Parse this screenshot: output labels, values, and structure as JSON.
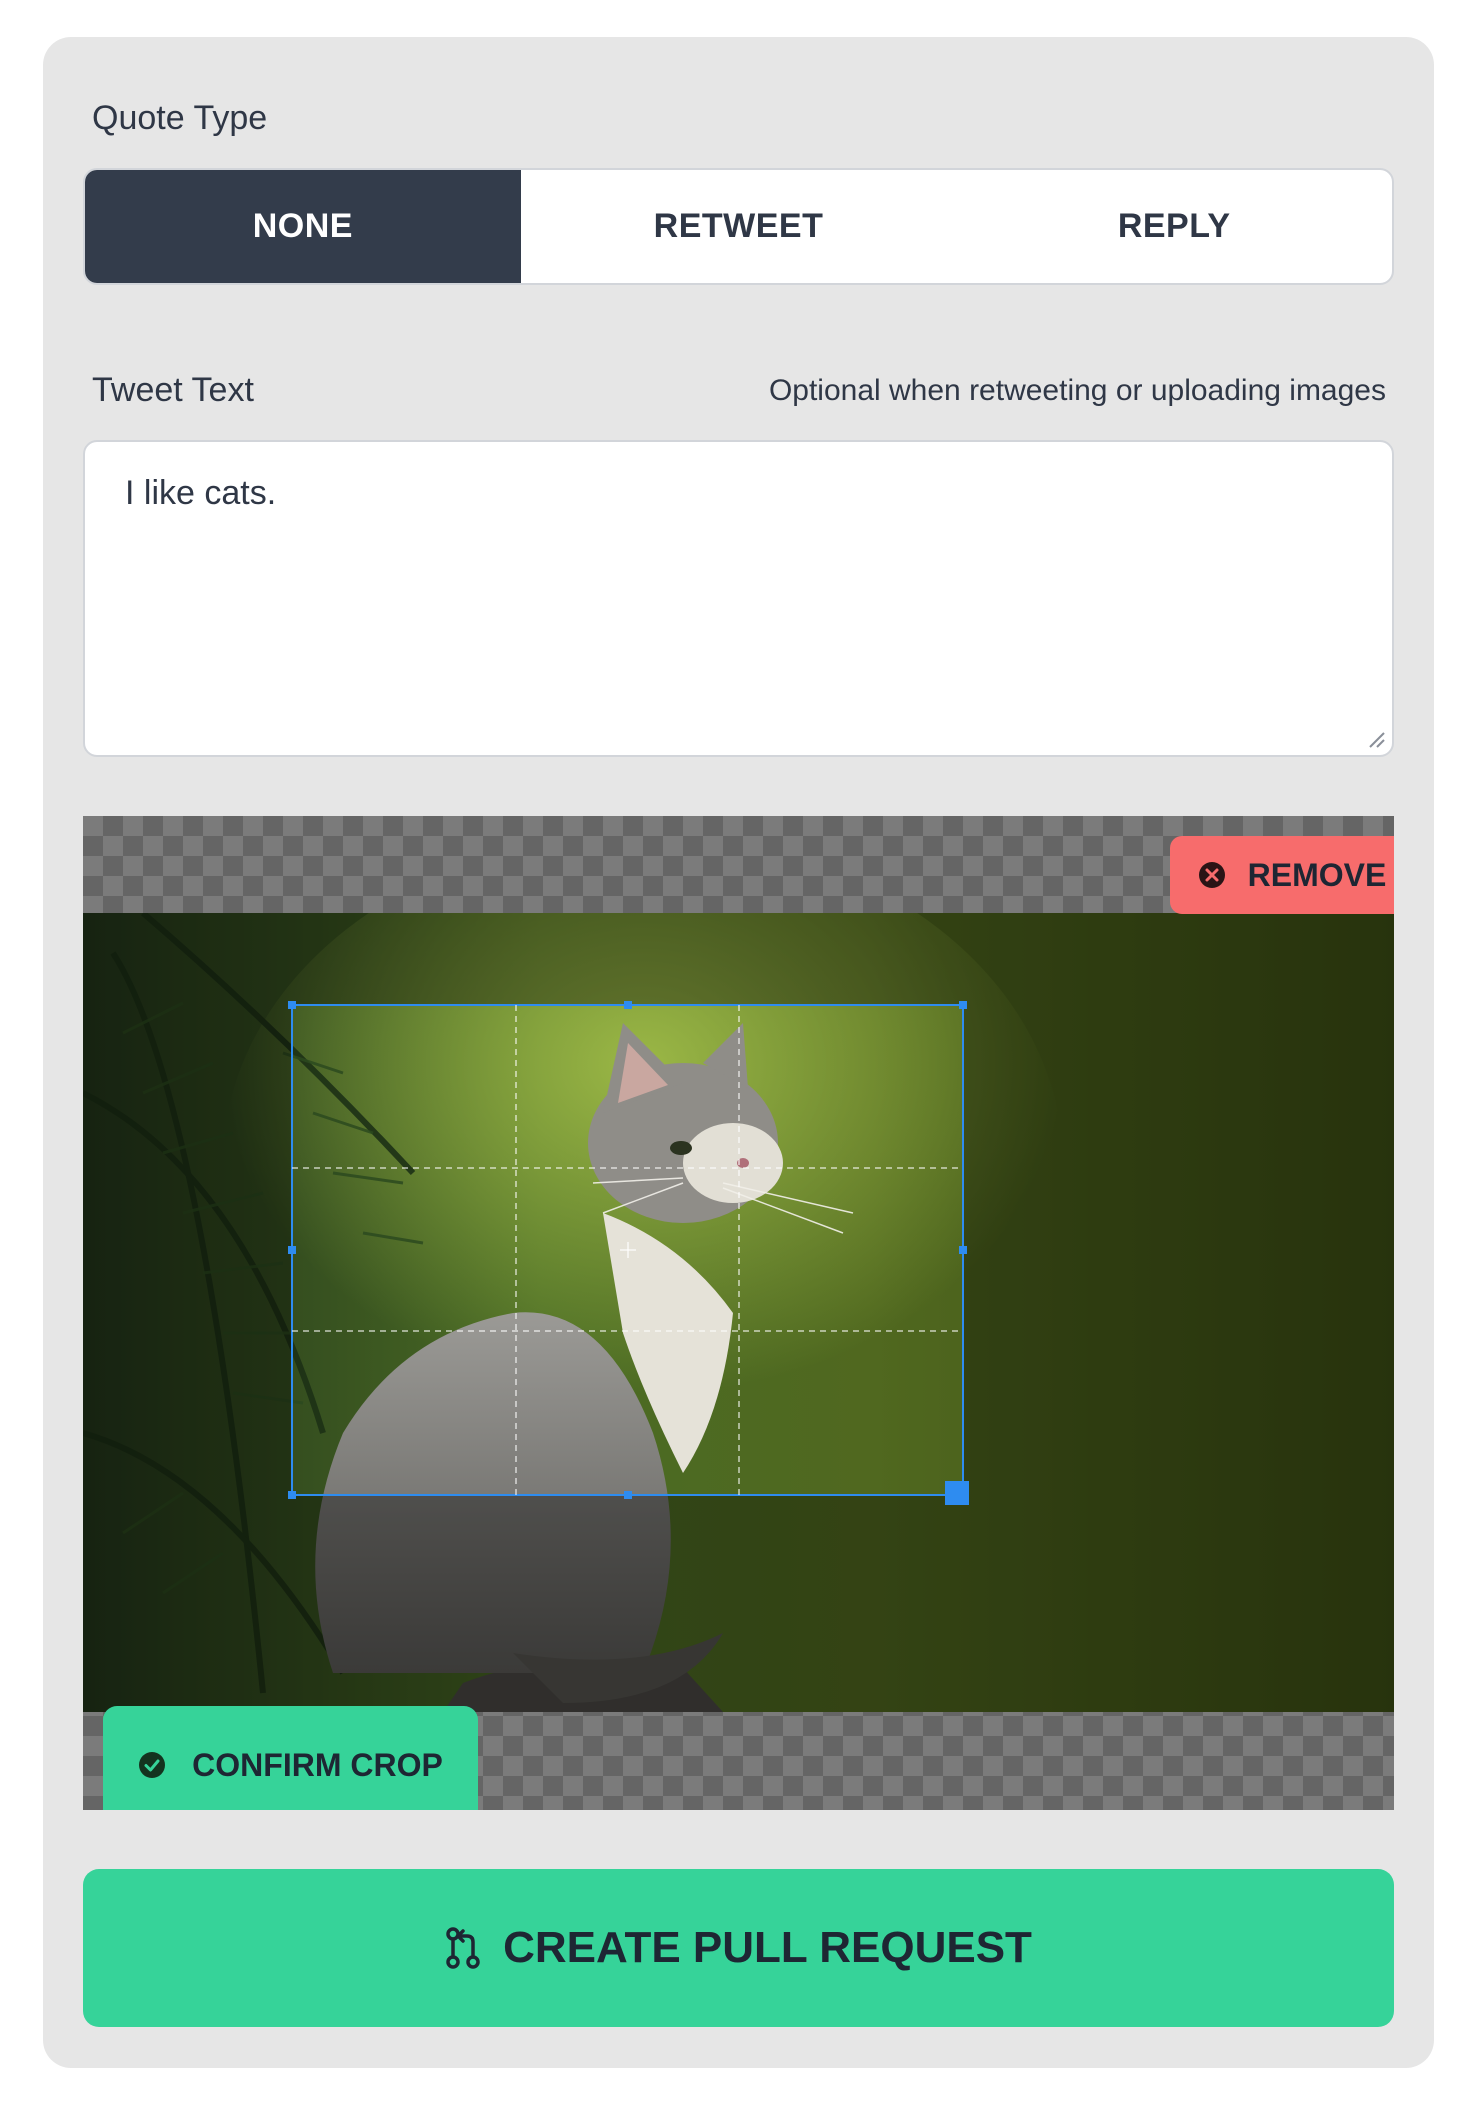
{
  "quote_type": {
    "label": "Quote Type",
    "options": [
      "NONE",
      "RETWEET",
      "REPLY"
    ],
    "selected": "NONE"
  },
  "tweet_text": {
    "label": "Tweet Text",
    "hint": "Optional when retweeting or uploading images",
    "value": "I like cats."
  },
  "image": {
    "remove_label": "REMOVE",
    "confirm_label": "CONFIRM CROP"
  },
  "actions": {
    "create_label": "CREATE PULL REQUEST"
  },
  "colors": {
    "card_bg": "#e6e6e6",
    "active_segment": "#333c4b",
    "confirm_green": "#36d399",
    "remove_red": "#f76c6c",
    "crop_blue": "#2e8cf0"
  },
  "icons": {
    "remove": "x-circle-icon",
    "confirm": "check-circle-icon",
    "create": "pull-request-icon"
  }
}
